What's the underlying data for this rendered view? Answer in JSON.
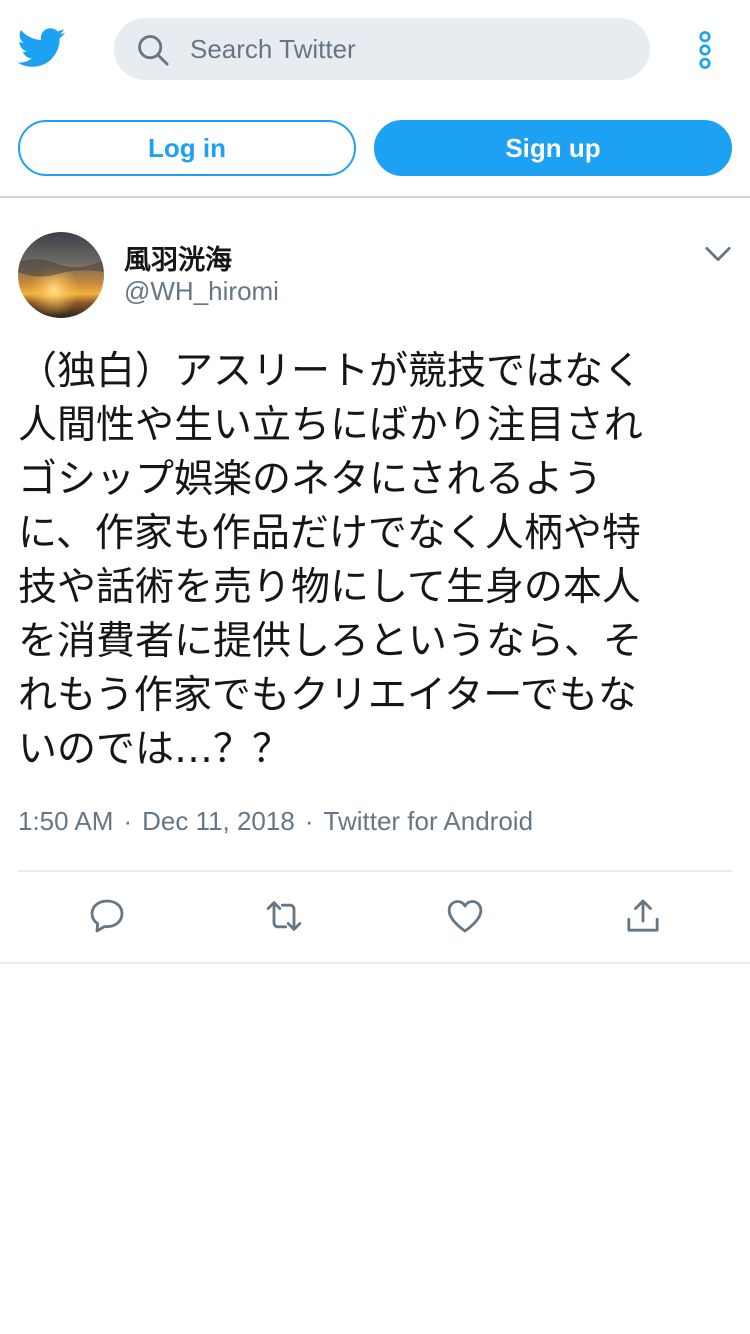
{
  "header": {
    "logo_icon": "twitter-bird-icon",
    "search_placeholder": "Search Twitter",
    "more_icon": "more-vertical-icon",
    "login_label": "Log in",
    "signup_label": "Sign up",
    "accent_color": "#1da1f2"
  },
  "tweet": {
    "author_name": "風羽洸海",
    "author_handle": "@WH_hiromi",
    "text": "（独白）アスリートが競技ではなく\n人間性や生い立ちにばかり注目され\nゴシップ娯楽のネタにされるよう\nに、作家も作品だけでなく人柄や特\n技や話術を売り物にして生身の本人\nを消費者に提供しろというなら、そ\nれもう作家でもクリエイターでもな\nいのでは…？？",
    "time": "1:50 AM",
    "date": "Dec 11, 2018",
    "source": "Twitter for Android",
    "separator": "·"
  },
  "actions": {
    "reply_icon": "reply-icon",
    "retweet_icon": "retweet-icon",
    "like_icon": "heart-icon",
    "share_icon": "share-icon"
  }
}
